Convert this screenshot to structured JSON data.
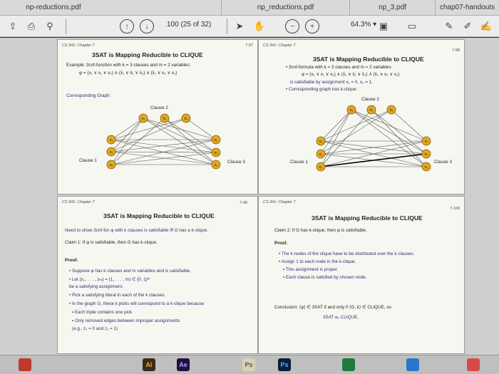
{
  "tabs": [
    "np-reductions.pdf",
    "np_reductions.pdf",
    "np_3.pdf",
    "chap07-handouts"
  ],
  "toolbar": {
    "page_value": "100",
    "page_total": "(25 of 32)",
    "zoom": "64.3%",
    "zoom_caret": "▾"
  },
  "slides": [
    {
      "header": "CS 341: Chapter 7",
      "page": "7-97",
      "title": "3SAT is Mapping Reducible to CLIQUE",
      "lines": [
        "Example:  3cnf-function with k = 3 clauses and m = 2 variables:",
        "φ = (x₁ ∨ x₁ ∨ x₂) ∧ (x̄₁ ∨ x̄₁ ∨ x̄₂) ∧ (x̄₁ ∨ x₂ ∨ x₂)",
        "Corresponding Graph:"
      ],
      "clause_labels": [
        "Clause 2",
        "Clause 1",
        "Clause 3"
      ]
    },
    {
      "header": "CS 341: Chapter 7",
      "page": "7-98",
      "title": "3SAT is Mapping Reducible to CLIQUE",
      "lines": [
        "• 3cnf-formula with k = 3 clauses and m = 2 variables:",
        "φ = (x₁ ∨ x₁ ∨ x₂) ∧ (x̄₁ ∨ x̄₁ ∨ x̄₂) ∧ (x̄₁ ∨ x₂ ∨ x₂)",
        "is satisfiable by assignment x₁ = 0, x₂ = 1.",
        "• Corresponding graph has k-clique:"
      ],
      "clause_labels": [
        "Clause 2",
        "Clause 1",
        "Clause 3"
      ]
    },
    {
      "header": "CS 341: Chapter 7",
      "page": "7-99",
      "title": "3SAT is Mapping Reducible to CLIQUE",
      "lines": [
        "Need to show 3cnf-fcn φ with k clauses is satisfiable iff G has a k-clique.",
        "Claim 1:  If φ is satisfiable, then G has k-clique.",
        "Proof.",
        "• Suppose φ has k clauses and m variables and is satisfiable.",
        "• Let (z₁, . . . , zₘ) = (1, . . . , m) ∈ {0, 1}ᵐ",
        "  be a satisfying assignment.",
        "• Pick a satisfying literal in each of the k clauses.",
        "• In the graph G, these k picks will correspond to a k-clique because",
        "    ▪ Each triple contains one pick",
        "    ▪ Only removed edges between improper assignments",
        "      (e.g., z₁ = 0 and z₁ = 1)"
      ]
    },
    {
      "header": "CS 341: Chapter 7",
      "page": "7-100",
      "title": "3SAT is Mapping Reducible to CLIQUE",
      "lines": [
        "Claim 2:  If G has k-clique, then φ is satisfiable.",
        "Proof.",
        "• The k nodes of the clique have to be distributed over the k clauses.",
        "• Assign 1 to each node in the k-clique.",
        "    ▪ This assignment is proper.",
        "    ▪ Each clause is satisfied by chosen node.",
        "Conclusion:  ⟨φ⟩ ∈ 3SAT if and only if ⟨G, k⟩ ∈ CLIQUE, so",
        "3SAT ≤ₚ CLIQUE."
      ]
    }
  ],
  "graph_nodes": {
    "top": [
      "x₁",
      "x̄₁",
      "x̄₂"
    ],
    "left": [
      "x₁",
      "x₁",
      "x₂"
    ],
    "right": [
      "x₁",
      "x₂",
      "x₂"
    ]
  },
  "dock_apps": [
    "Ai",
    "Ae",
    "Ps",
    "Ps"
  ],
  "colors": {
    "node": "#e3a81e",
    "edge": "#555555",
    "clique_edge": "#000000",
    "page_bg": "#f7f7f2"
  }
}
